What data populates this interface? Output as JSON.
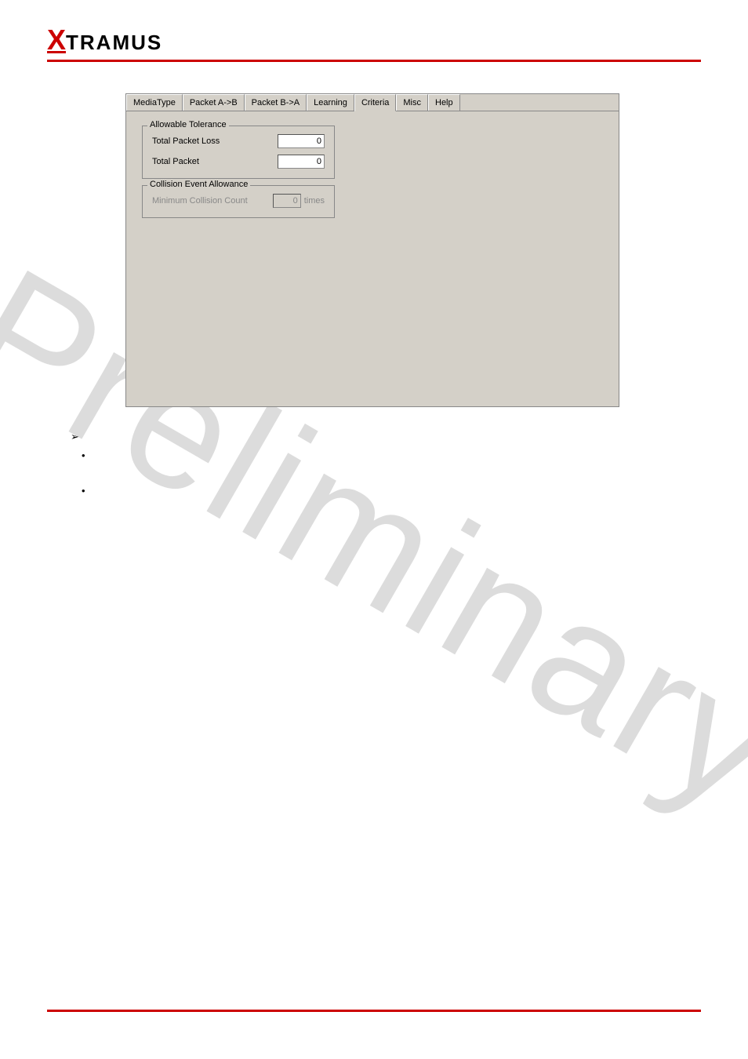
{
  "logo": {
    "x": "X",
    "rest": "TRAMUS"
  },
  "watermark": "Preliminary",
  "panel": {
    "tabs": [
      {
        "label": "MediaType"
      },
      {
        "label": "Packet A->B"
      },
      {
        "label": "Packet B->A"
      },
      {
        "label": "Learning"
      },
      {
        "label": "Criteria"
      },
      {
        "label": "Misc"
      },
      {
        "label": "Help"
      }
    ],
    "active_tab_index": 4,
    "group1": {
      "title": "Allowable Tolerance",
      "fields": [
        {
          "label": "Total Packet Loss",
          "value": "0"
        },
        {
          "label": "Total Packet",
          "value": "0"
        }
      ]
    },
    "group2": {
      "title": "Collision Event Allowance",
      "fields": [
        {
          "label": "Minimum Collision Count",
          "value": "0",
          "unit": "times",
          "disabled": true
        }
      ]
    }
  }
}
